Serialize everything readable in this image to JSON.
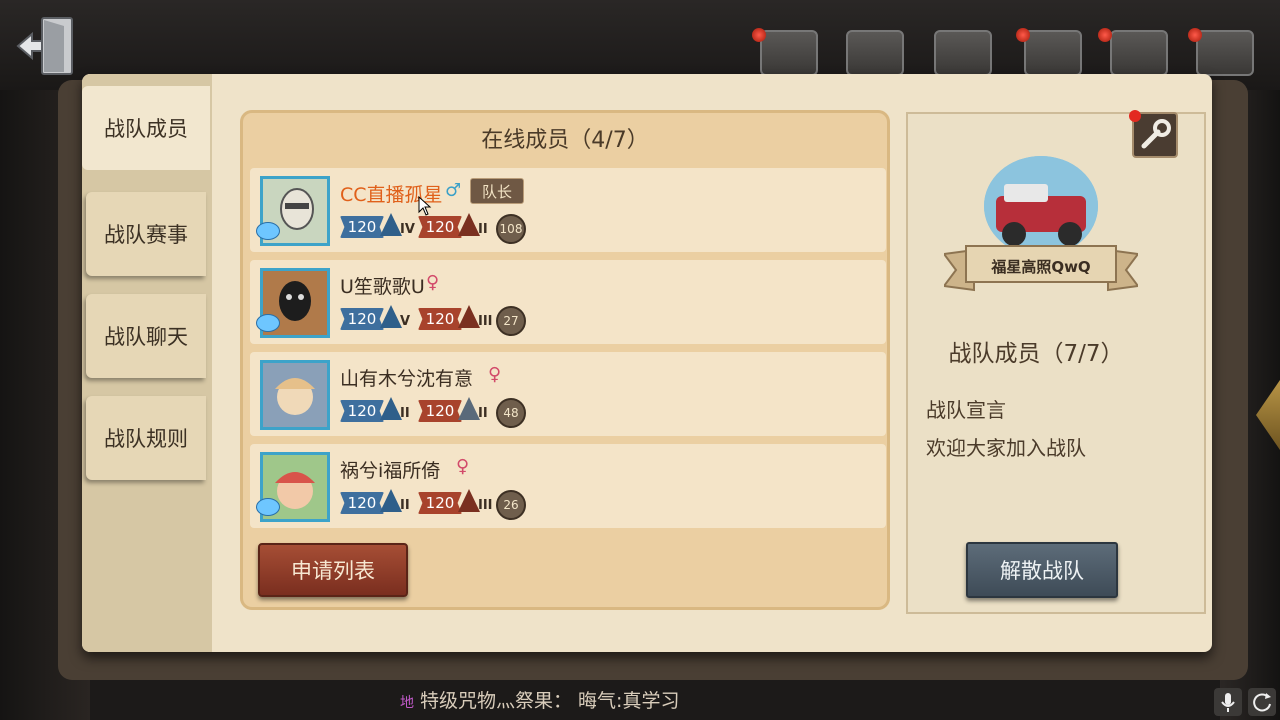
{
  "tabs": [
    {
      "label": "战队成员",
      "active": true
    },
    {
      "label": "战队赛事",
      "active": false
    },
    {
      "label": "战队聊天",
      "active": false
    },
    {
      "label": "战队规则",
      "active": false
    }
  ],
  "members_panel": {
    "title": "在线成员（4/7）",
    "captain_badge": "队长",
    "apply_list_button": "申请列表",
    "members": [
      {
        "name": "CC直播孤星",
        "gender": "♂",
        "is_captain": true,
        "survivor_rank": {
          "label": "120",
          "tier": "IV"
        },
        "hunter_rank": {
          "label": "120",
          "tier": "II"
        },
        "level": "108"
      },
      {
        "name": "U笙歌歌U",
        "gender": "♀",
        "is_captain": false,
        "survivor_rank": {
          "label": "120",
          "tier": "V"
        },
        "hunter_rank": {
          "label": "120",
          "tier": "III"
        },
        "level": "27"
      },
      {
        "name": "山有木兮沈有意",
        "gender": "♀",
        "is_captain": false,
        "survivor_rank": {
          "label": "120",
          "tier": "II"
        },
        "hunter_rank": {
          "label": "120",
          "tier": "II"
        },
        "level": "48"
      },
      {
        "name": "祸兮i福所倚",
        "gender": "♀",
        "is_captain": false,
        "survivor_rank": {
          "label": "120",
          "tier": "II"
        },
        "hunter_rank": {
          "label": "120",
          "tier": "III"
        },
        "level": "26"
      }
    ]
  },
  "team_info": {
    "team_name": "福星高照QwQ",
    "member_count": "战队成员（7/7）",
    "declaration_label": "战队宣言",
    "declaration_text": "欢迎大家加入战队",
    "disband_button": "解散战队",
    "settings_icon": "wrench-icon"
  },
  "bottom_bar": {
    "chat_prefix": "地",
    "chat_text": "特级咒物灬祭果： 晦气:真学习",
    "mic_icon": "microphone-icon",
    "refresh_icon": "refresh-icon"
  },
  "colors": {
    "captain_name": "#e0601a",
    "male": "#3aa0c8",
    "female": "#d24a6a",
    "apply_button": "#a64e35",
    "disband_button": "#5d6c79"
  }
}
